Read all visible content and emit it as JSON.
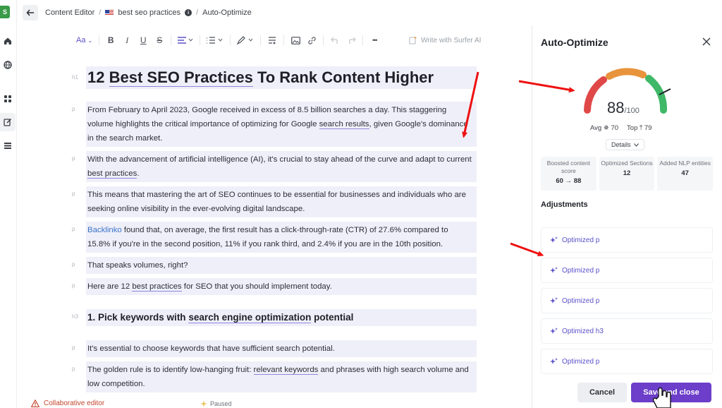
{
  "rail": {
    "logo": "S",
    "icons": [
      "home-icon",
      "globe-icon",
      "apps-icon",
      "edit-icon",
      "list-icon"
    ]
  },
  "breadcrumb": {
    "items": [
      "Content Editor",
      "best seo practices",
      "Auto-Optimize"
    ],
    "separator": "/"
  },
  "toolbar": {
    "text_style": "Aa",
    "bold": "B",
    "italic": "I",
    "underline": "U",
    "strike": "S",
    "more": "•••",
    "write_with_ai": "Write with Surfer AI"
  },
  "document": {
    "blocks": [
      {
        "tag": "h1",
        "parts": [
          {
            "t": "12 "
          },
          {
            "t": "Best SEO Practices",
            "kw": true
          },
          {
            "t": " To Rank Content Higher"
          }
        ]
      },
      {
        "tag": "p",
        "parts": [
          {
            "t": "From February to April 2023, Google received in excess of 8.5 billion searches a day. This staggering volume highlights the critical importance of optimizing for Google "
          },
          {
            "t": "search results",
            "kw": true
          },
          {
            "t": ", given Google's dominance in the search market."
          }
        ]
      },
      {
        "tag": "p",
        "parts": [
          {
            "t": "With the advancement of artificial intelligence (AI), it's crucial to stay ahead of the curve and adapt to current "
          },
          {
            "t": "best practices",
            "kw": true
          },
          {
            "t": "."
          }
        ]
      },
      {
        "tag": "p",
        "parts": [
          {
            "t": "This means that mastering the art of SEO continues to be essential for businesses and individuals who are seeking online visibility in the ever-evolving digital landscape."
          }
        ]
      },
      {
        "tag": "p",
        "parts": [
          {
            "t": "Backlinko",
            "link": true
          },
          {
            "t": " found that, on average, the first result has a click-through-rate (CTR) of 27.6% compared to 15.8% if you're in the second position, 11% if you rank third, and 2.4% if you are in the 10th position."
          }
        ]
      },
      {
        "tag": "p",
        "parts": [
          {
            "t": "That speaks volumes, right?"
          }
        ]
      },
      {
        "tag": "p",
        "parts": [
          {
            "t": "Here are 12 "
          },
          {
            "t": "best practices",
            "kw": true
          },
          {
            "t": " for SEO that you should implement today."
          }
        ]
      },
      {
        "tag": "h3",
        "parts": [
          {
            "t": "1. Pick keywords with "
          },
          {
            "t": "search engine optimization",
            "kw": true
          },
          {
            "t": " potential"
          }
        ]
      },
      {
        "tag": "p",
        "parts": [
          {
            "t": "It's essential to choose keywords that have sufficient search potential."
          }
        ]
      },
      {
        "tag": "p",
        "parts": [
          {
            "t": "The golden rule is to identify low-hanging fruit: "
          },
          {
            "t": "relevant keywords",
            "kw": true
          },
          {
            "t": " and phrases with high search volume and low competition."
          }
        ]
      }
    ]
  },
  "status": {
    "collab": "Collaborative editor",
    "paused": "Paused"
  },
  "panel": {
    "title": "Auto-Optimize",
    "score": "88",
    "score_max": "/100",
    "score_value": 88,
    "avg_label": "Avg",
    "avg_value": "70",
    "top_label": "Top",
    "top_value": "79",
    "details_label": "Details",
    "stats": [
      {
        "label": "Boosted content score",
        "value": "60 → 88"
      },
      {
        "label": "Optimized Sections",
        "value": "12"
      },
      {
        "label": "Added NLP entities",
        "value": "47"
      }
    ],
    "adjustments_title": "Adjustments",
    "adjustments": [
      "Optimized p",
      "Optimized p",
      "Optimized p",
      "Optimized h3",
      "Optimized p"
    ],
    "cancel_label": "Cancel",
    "save_label": "Save and close",
    "colors": {
      "accent": "#6c3ec9",
      "gauge_red": "#e04848",
      "gauge_orange": "#e8943c",
      "gauge_green": "#3fb868",
      "annotation": "#ee1111"
    }
  }
}
